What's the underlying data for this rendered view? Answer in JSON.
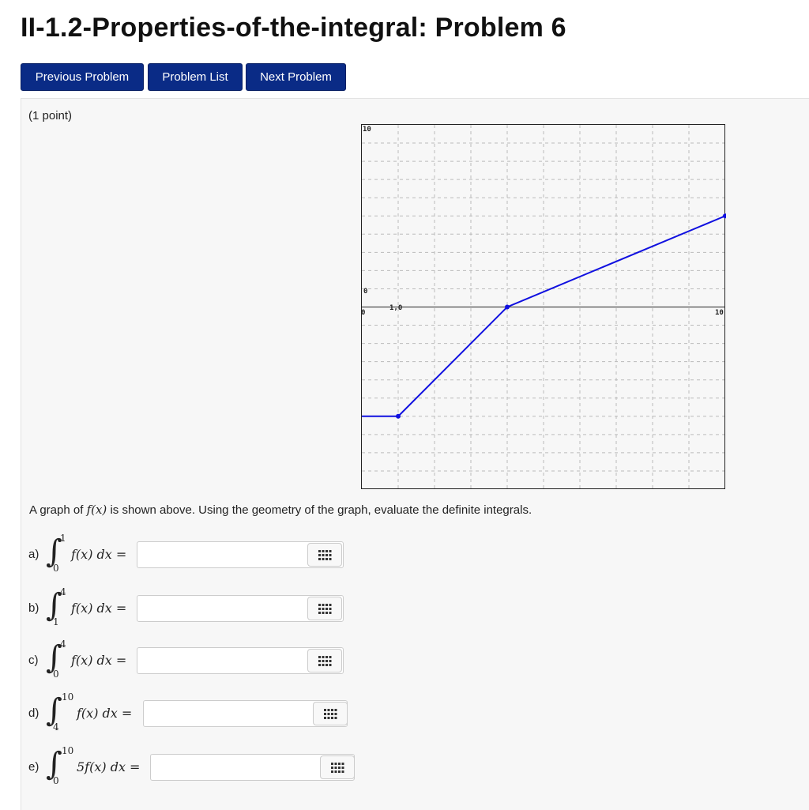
{
  "page": {
    "title": "II-1.2-Properties-of-the-integral: Problem 6"
  },
  "nav": {
    "previous": "Previous Problem",
    "list": "Problem List",
    "next": "Next Problem"
  },
  "problem": {
    "points": "(1 point)",
    "description_prefix": "A graph of ",
    "description_func": "f(x)",
    "description_suffix": " is shown above. Using the geometry of the graph, evaluate the definite integrals."
  },
  "graph": {
    "labels": {
      "y_top": "10",
      "y_origin": "0",
      "x_left": "0",
      "x_one": "1,0",
      "x_right": "10"
    },
    "chart_data": {
      "type": "line",
      "xlim": [
        0,
        10
      ],
      "ylim": [
        -10,
        10
      ],
      "grid": true,
      "series": [
        {
          "x": [
            0,
            1,
            4,
            10
          ],
          "y": [
            -6,
            -6,
            0,
            5
          ]
        }
      ],
      "marked_points": [
        {
          "x": 1,
          "y": -6
        },
        {
          "x": 4,
          "y": 0
        },
        {
          "x": 10,
          "y": 5
        }
      ]
    },
    "line_color": "#1010e0"
  },
  "questions": [
    {
      "label": "a)",
      "upper": "1",
      "lower": "0",
      "expr": "f(x) dx =",
      "value": ""
    },
    {
      "label": "b)",
      "upper": "4",
      "lower": "1",
      "expr": "f(x) dx =",
      "value": ""
    },
    {
      "label": "c)",
      "upper": "4",
      "lower": "0",
      "expr": "f(x) dx =",
      "value": ""
    },
    {
      "label": "d)",
      "upper": "10",
      "lower": "4",
      "expr": "f(x) dx =",
      "value": ""
    },
    {
      "label": "e)",
      "upper": "10",
      "lower": "0",
      "expr": "5f(x) dx =",
      "value": ""
    }
  ],
  "colors": {
    "button_bg": "#0a2b86",
    "panel_bg": "#f7f7f7"
  }
}
